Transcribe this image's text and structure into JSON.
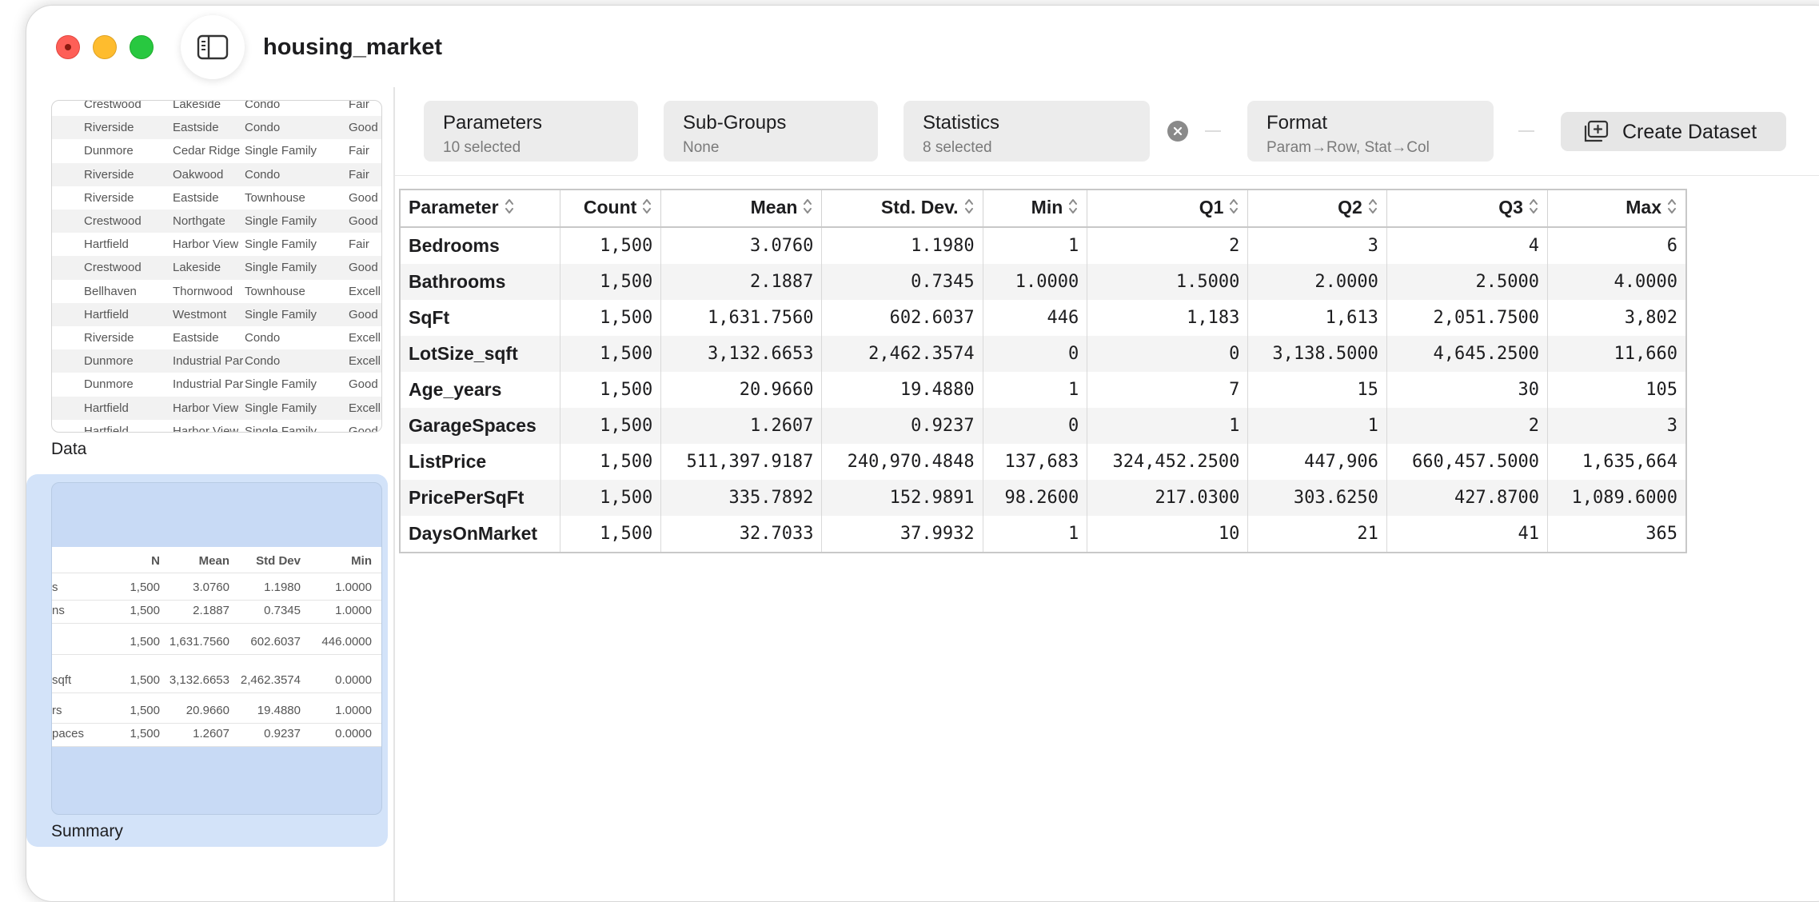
{
  "window": {
    "title": "housing_market"
  },
  "sidebar": {
    "data_label": "Data",
    "summary_label": "Summary",
    "data_preview": [
      [
        "Crestwood",
        "Lakeside",
        "Condo",
        "Fair"
      ],
      [
        "Riverside",
        "Eastside",
        "Condo",
        "Good"
      ],
      [
        "Dunmore",
        "Cedar Ridge",
        "Single Family",
        "Fair"
      ],
      [
        "Riverside",
        "Oakwood",
        "Condo",
        "Fair"
      ],
      [
        "Riverside",
        "Eastside",
        "Townhouse",
        "Good"
      ],
      [
        "Crestwood",
        "Northgate",
        "Single Family",
        "Good"
      ],
      [
        "Hartfield",
        "Harbor View",
        "Single Family",
        "Fair"
      ],
      [
        "Crestwood",
        "Lakeside",
        "Single Family",
        "Good"
      ],
      [
        "Bellhaven",
        "Thornwood",
        "Townhouse",
        "Excell"
      ],
      [
        "Hartfield",
        "Westmont",
        "Single Family",
        "Good"
      ],
      [
        "Riverside",
        "Eastside",
        "Condo",
        "Excell"
      ],
      [
        "Dunmore",
        "Industrial Park",
        "Condo",
        "Excell"
      ],
      [
        "Dunmore",
        "Industrial Park",
        "Single Family",
        "Good"
      ],
      [
        "Hartfield",
        "Harbor View",
        "Single Family",
        "Excell"
      ],
      [
        "Hartfield",
        "Harbor View",
        "Single Family",
        "Good"
      ]
    ],
    "summary_preview": {
      "headers": [
        "N",
        "Mean",
        "Std Dev",
        "Min"
      ],
      "rows": [
        [
          "s",
          "1,500",
          "3.0760",
          "1.1980",
          "1.0000"
        ],
        [
          "ns",
          "1,500",
          "2.1887",
          "0.7345",
          "1.0000"
        ],
        [
          "",
          "1,500",
          "1,631.7560",
          "602.6037",
          "446.0000"
        ],
        [
          "sqft",
          "1,500",
          "3,132.6653",
          "2,462.3574",
          "0.0000"
        ],
        [
          "rs",
          "1,500",
          "20.9660",
          "19.4880",
          "1.0000"
        ],
        [
          "paces",
          "1,500",
          "1.2607",
          "0.9237",
          "0.0000"
        ]
      ]
    }
  },
  "toolbar": {
    "parameters": {
      "title": "Parameters",
      "sub": "10 selected"
    },
    "subgroups": {
      "title": "Sub-Groups",
      "sub": "None"
    },
    "statistics": {
      "title": "Statistics",
      "sub": "8 selected"
    },
    "format": {
      "title": "Format",
      "sub": "Param→Row, Stat→Col"
    },
    "create_dataset": "Create Dataset"
  },
  "table": {
    "columns": [
      "Parameter",
      "Count",
      "Mean",
      "Std. Dev.",
      "Min",
      "Q1",
      "Q2",
      "Q3",
      "Max"
    ],
    "rows": [
      [
        "Bedrooms",
        "1,500",
        "3.0760",
        "1.1980",
        "1",
        "2",
        "3",
        "4",
        "6"
      ],
      [
        "Bathrooms",
        "1,500",
        "2.1887",
        "0.7345",
        "1.0000",
        "1.5000",
        "2.0000",
        "2.5000",
        "4.0000"
      ],
      [
        "SqFt",
        "1,500",
        "1,631.7560",
        "602.6037",
        "446",
        "1,183",
        "1,613",
        "2,051.7500",
        "3,802"
      ],
      [
        "LotSize_sqft",
        "1,500",
        "3,132.6653",
        "2,462.3574",
        "0",
        "0",
        "3,138.5000",
        "4,645.2500",
        "11,660"
      ],
      [
        "Age_years",
        "1,500",
        "20.9660",
        "19.4880",
        "1",
        "7",
        "15",
        "30",
        "105"
      ],
      [
        "GarageSpaces",
        "1,500",
        "1.2607",
        "0.9237",
        "0",
        "1",
        "1",
        "2",
        "3"
      ],
      [
        "ListPrice",
        "1,500",
        "511,397.9187",
        "240,970.4848",
        "137,683",
        "324,452.2500",
        "447,906",
        "660,457.5000",
        "1,635,664"
      ],
      [
        "PricePerSqFt",
        "1,500",
        "335.7892",
        "152.9891",
        "98.2600",
        "217.0300",
        "303.6250",
        "427.8700",
        "1,089.6000"
      ],
      [
        "DaysOnMarket",
        "1,500",
        "32.7033",
        "37.9932",
        "1",
        "10",
        "21",
        "41",
        "365"
      ]
    ]
  }
}
